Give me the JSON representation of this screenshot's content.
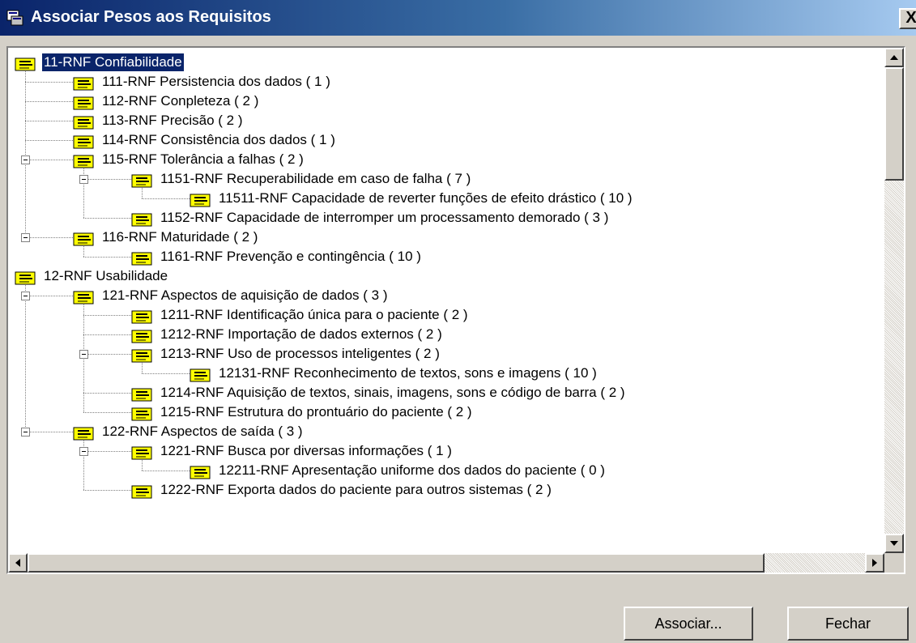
{
  "window": {
    "title": "Associar Pesos aos Requisitos",
    "close_label": "X"
  },
  "tree": {
    "nodes": [
      {
        "label": "11-RNF Confiabilidade",
        "level": 0,
        "expanded": true,
        "selected": true
      },
      {
        "label": "111-RNF Persistencia dos dados ( 1 )",
        "level": 1
      },
      {
        "label": "112-RNF Conpleteza  ( 2 )",
        "level": 1
      },
      {
        "label": "113-RNF Precisão ( 2 )",
        "level": 1
      },
      {
        "label": "114-RNF Consistência dos dados ( 1 )",
        "level": 1
      },
      {
        "label": "115-RNF Tolerância a falhas ( 2 )",
        "level": 1,
        "expanded": true
      },
      {
        "label": "1151-RNF Recuperabilidade em caso de falha ( 7 )",
        "level": 2,
        "expanded": true
      },
      {
        "label": "11511-RNF Capacidade de reverter funções de efeito drástico ( 10 )",
        "level": 3
      },
      {
        "label": "1152-RNF Capacidade de interromper um processamento demorado ( 3 )",
        "level": 2
      },
      {
        "label": "116-RNF Maturidade ( 2 )",
        "level": 1,
        "expanded": true
      },
      {
        "label": "1161-RNF Prevenção e contingência  ( 10 )",
        "level": 2
      },
      {
        "label": "12-RNF Usabilidade",
        "level": 0,
        "expanded": true
      },
      {
        "label": "121-RNF Aspectos de aquisição de dados ( 3 )",
        "level": 1,
        "expanded": true
      },
      {
        "label": "1211-RNF Identificação única para o paciente ( 2 )",
        "level": 2
      },
      {
        "label": "1212-RNF Importação de dados externos ( 2 )",
        "level": 2
      },
      {
        "label": "1213-RNF Uso de processos inteligentes ( 2 )",
        "level": 2,
        "expanded": true
      },
      {
        "label": "12131-RNF Reconhecimento de textos, sons e imagens ( 10 )",
        "level": 3
      },
      {
        "label": "1214-RNF Aquisição de textos, sinais, imagens, sons e código de barra ( 2 )",
        "level": 2
      },
      {
        "label": "1215-RNF Estrutura do prontuário do paciente ( 2 )",
        "level": 2
      },
      {
        "label": "122-RNF Aspectos de saída ( 3 )",
        "level": 1,
        "expanded": true
      },
      {
        "label": "1221-RNF Busca por diversas informações ( 1 )",
        "level": 2,
        "expanded": true
      },
      {
        "label": "12211-RNF Apresentação uniforme dos dados do paciente ( 0 )",
        "level": 3
      },
      {
        "label": "1222-RNF Exporta dados do paciente para outros sistemas ( 2 )",
        "level": 2
      }
    ]
  },
  "buttons": {
    "associate_label": "Associar...",
    "close_label": "Fechar"
  },
  "colors": {
    "selection": "#0a246a",
    "node_icon": "#ffff00",
    "window_face": "#d4d0c8"
  }
}
